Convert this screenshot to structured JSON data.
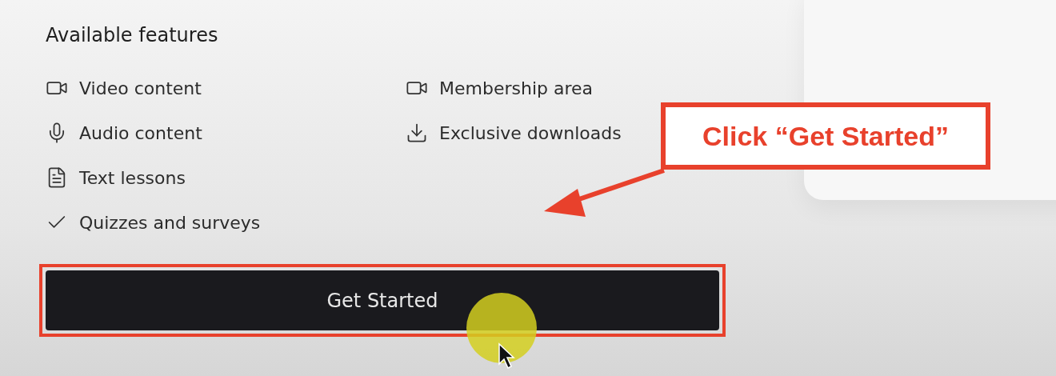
{
  "section": {
    "title": "Available features"
  },
  "feature_columns": [
    [
      {
        "label": "Video content",
        "kind": "video"
      },
      {
        "label": "Audio content",
        "kind": "audio"
      },
      {
        "label": "Text lessons",
        "kind": "text"
      },
      {
        "label": "Quizzes and surveys",
        "kind": "quiz"
      }
    ],
    [
      {
        "label": "Membership area",
        "kind": "video"
      },
      {
        "label": "Exclusive downloads",
        "kind": "download"
      }
    ]
  ],
  "button": {
    "label": "Get Started",
    "highlighted": true
  },
  "annotation": {
    "callout": "Click “Get Started”"
  }
}
